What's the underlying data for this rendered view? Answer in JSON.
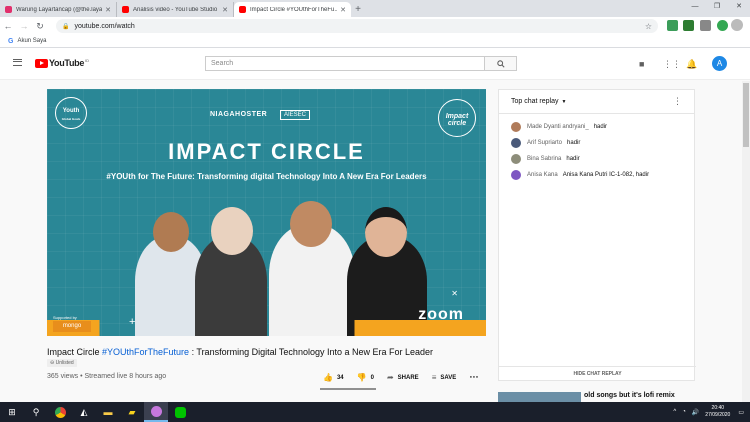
{
  "browser": {
    "tabs": [
      {
        "title": "Warung Layartancap (@the.laya...",
        "favicon_color": "#e1306c"
      },
      {
        "title": "Analisis video - YouTube Studio",
        "favicon_color": "#ff0000"
      },
      {
        "title": "Impact Circle #YOUthForTheFu...",
        "favicon_color": "#ff0000",
        "active": true
      }
    ],
    "url": "youtube.com/watch",
    "bookmark": "Akun Saya"
  },
  "header": {
    "logo_text": "YouTube",
    "logo_sup": "ID",
    "search_placeholder": "Search",
    "avatar_letter": "A"
  },
  "video_frame": {
    "badge_left": "Youth",
    "badge_left_sub": "Global Goals",
    "badge_right": "Impact circle",
    "sponsor": "NIAGAHOSTER",
    "sponsor2": "AIESEC",
    "title": "IMPACT CIRCLE",
    "subtitle": "#YOUth for The Future: Transforming digital Technology Into A New Era For Leaders",
    "supported_by": "Supported by",
    "supporter": "mongo",
    "zoom": "zoom"
  },
  "video": {
    "title_main": "Impact Circle ",
    "title_tag": "#YOUthForTheFuture",
    "title_rest": " : Transforming Digital Technology Into a New Era For Leader",
    "unlisted": "Unlisted",
    "views": "365 views",
    "streamed": "Streamed live 8 hours ago",
    "likes": "34",
    "dislikes": "0",
    "share_label": "SHARE",
    "save_label": "SAVE",
    "like_ratio": 1.0
  },
  "chat": {
    "header": "Top chat replay",
    "messages": [
      {
        "author": "Made Dyanti andryani_",
        "text": "hadir",
        "color": "#b07b5a"
      },
      {
        "author": "Arif Supriarto",
        "text": "hadir",
        "color": "#4a5a7a"
      },
      {
        "author": "Bina Sabrina",
        "text": "hadir",
        "color": "#8d8d7a"
      },
      {
        "author": "Anisa Kana",
        "text": "Anisa Kana Putri IC-1-082, hadir",
        "color": "#7e57c2"
      }
    ],
    "footer": "HIDE CHAT REPLAY"
  },
  "recommended": {
    "title": "old songs but it's lofi remix"
  },
  "taskbar": {
    "time": "20:40",
    "date": "27/09/2020"
  }
}
